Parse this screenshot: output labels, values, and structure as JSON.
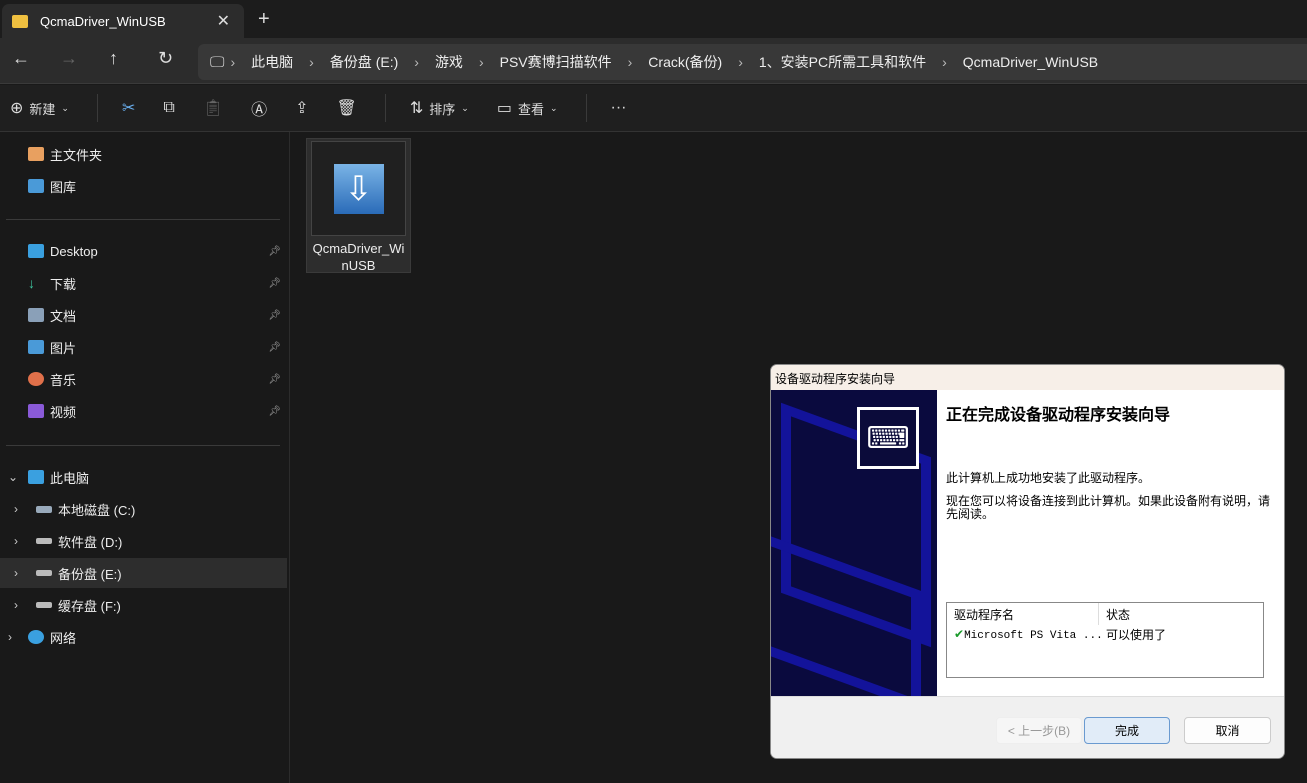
{
  "tab": {
    "title": "QcmaDriver_WinUSB",
    "close": "✕",
    "new": "+"
  },
  "breadcrumb": [
    "此电脑",
    "备份盘 (E:)",
    "游戏",
    "PSV赛博扫描软件",
    "Crack(备份)",
    "1、安装PC所需工具和软件",
    "QcmaDriver_WinUSB"
  ],
  "toolbar": {
    "new": "新建",
    "sort": "排序",
    "view": "查看",
    "more": "···"
  },
  "sidebar": {
    "quick": [
      "主文件夹",
      "图库"
    ],
    "pinned": [
      "Desktop",
      "下载",
      "文档",
      "图片",
      "音乐",
      "视频"
    ],
    "this_pc": "此电脑",
    "drives": [
      "本地磁盘 (C:)",
      "软件盘 (D:)",
      "备份盘 (E:)",
      "缓存盘 (F:)"
    ],
    "network": "网络"
  },
  "file": {
    "name": "QcmaDriver_WinUSB"
  },
  "dialog": {
    "title": "设备驱动程序安装向导",
    "heading": "正在完成设备驱动程序安装向导",
    "p1": "此计算机上成功地安装了此驱动程序。",
    "p2": "现在您可以将设备连接到此计算机。如果此设备附有说明，请先阅读。",
    "col_name": "驱动程序名",
    "col_status": "状态",
    "rows": [
      {
        "name": "Microsoft PS Vita ...",
        "status": "可以使用了"
      }
    ],
    "back": "< 上一步(B)",
    "finish": "完成",
    "cancel": "取消"
  }
}
